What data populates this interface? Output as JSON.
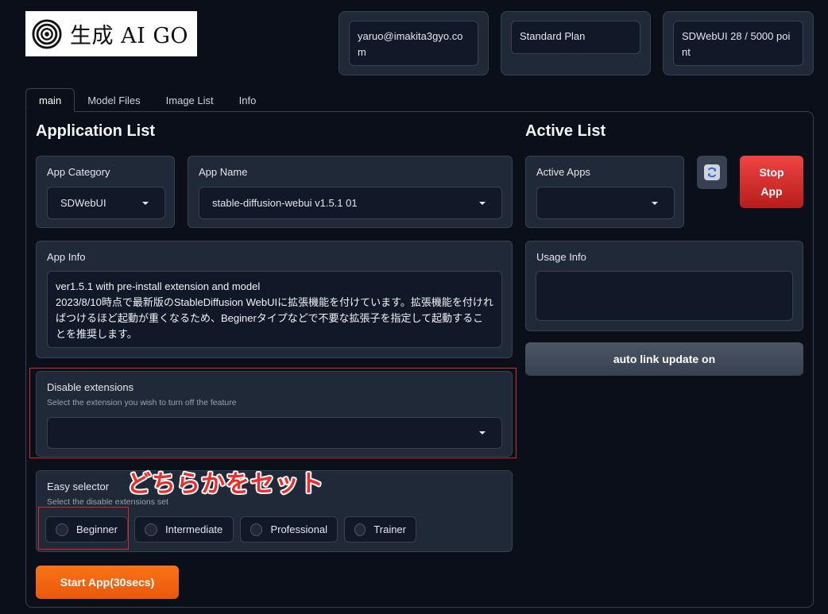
{
  "logo": {
    "text": "生成 AI GO"
  },
  "account": {
    "email": "yaruo@imakita3gyo.com",
    "plan": "Standard Plan",
    "points": "SDWebUI 28 / 5000 point"
  },
  "tabs": [
    {
      "label": "main",
      "active": true
    },
    {
      "label": "Model Files"
    },
    {
      "label": "Image List"
    },
    {
      "label": "Info"
    }
  ],
  "app_list": {
    "heading": "Application List",
    "category": {
      "label": "App Category",
      "value": "SDWebUI"
    },
    "name": {
      "label": "App Name",
      "value": "stable-diffusion-webui v1.5.1 01"
    },
    "info": {
      "label": "App Info",
      "text_line1": "ver1.5.1 with pre-install extension and model",
      "text_line2": "2023/8/10時点で最新版のStableDiffusion WebUIに拡張機能を付けています。拡張機能を付ければつけるほど起動が重くなるため、Beginerタイプなどで不要な拡張子を指定して起動することを推奨します。"
    },
    "disable_ext": {
      "label": "Disable extensions",
      "sublabel": "Select the extension you wish to turn off the feature",
      "value": ""
    },
    "easy_selector": {
      "label": "Easy selector",
      "sublabel": "Select the disable extensions set",
      "options": [
        "Beginner",
        "Intermediate",
        "Professional",
        "Trainer"
      ]
    },
    "start_button": "Start App(30secs)"
  },
  "active_list": {
    "heading": "Active List",
    "active_apps": {
      "label": "Active Apps",
      "value": ""
    },
    "stop_button": "Stop App",
    "usage_info": {
      "label": "Usage Info",
      "value": ""
    },
    "autolink_button": "auto link update on"
  },
  "annotation": "どちらかをセット",
  "colors": {
    "background": "#0b0f19",
    "panel": "#1f2937",
    "accent_orange": "#f97316",
    "stop_red": "#dc2626",
    "annotation_red": "#ef2b2b"
  }
}
